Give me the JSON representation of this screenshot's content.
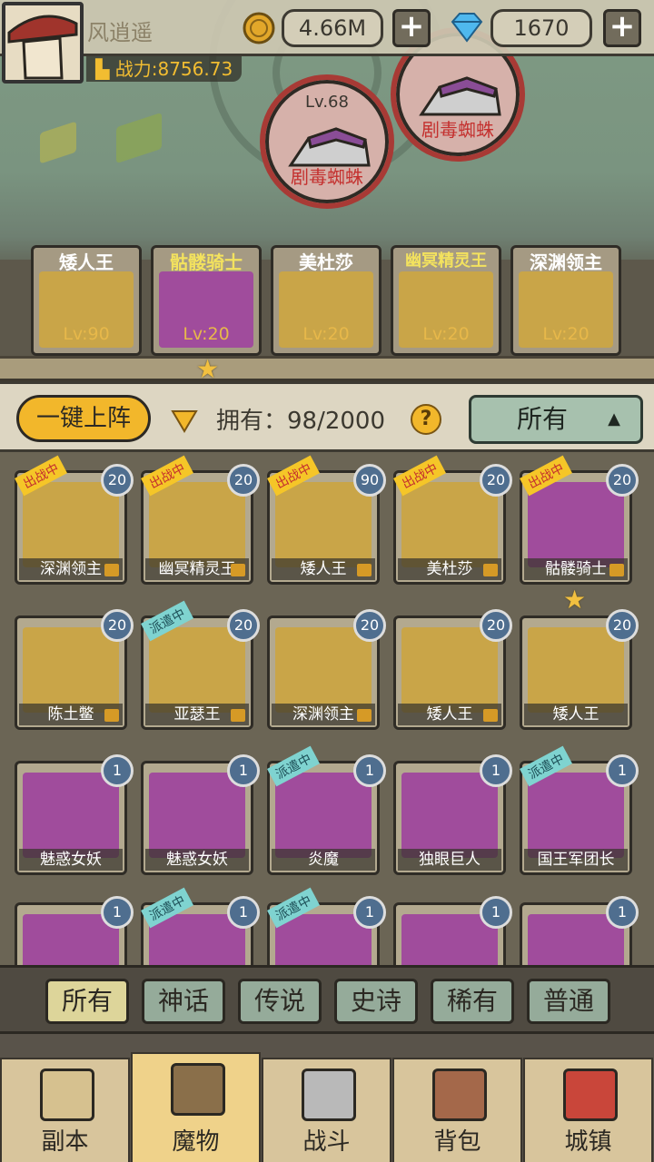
{
  "header": {
    "player_name": "风逍遥",
    "power_text": "战力:8756.73",
    "gold": "4.66M",
    "diamond": "1670"
  },
  "map_monsters": [
    {
      "level": "Lv.68",
      "name": "剧毒蜘蛛"
    },
    {
      "level": "",
      "name": "剧毒蜘蛛"
    }
  ],
  "team": [
    {
      "name": "矮人王",
      "level": "Lv:90",
      "rarity": "gold"
    },
    {
      "name": "骷髅骑士",
      "level": "Lv:20",
      "rarity": "purple"
    },
    {
      "name": "美杜莎",
      "level": "Lv:20",
      "rarity": "gold"
    },
    {
      "name": "幽冥精灵王",
      "level": "Lv:20",
      "rarity": "gold"
    },
    {
      "name": "深渊领主",
      "level": "Lv:20",
      "rarity": "gold"
    }
  ],
  "toolbar": {
    "auto_deploy_label": "一键上阵",
    "owned_label": "拥有：98/2000",
    "help": "?",
    "filter_value": "所有"
  },
  "grid": [
    {
      "name": "深渊领主",
      "badge": "20",
      "ribbon": "出战中",
      "rarity": "gold",
      "locked": true
    },
    {
      "name": "幽冥精灵王",
      "badge": "20",
      "ribbon": "出战中",
      "rarity": "gold",
      "locked": true
    },
    {
      "name": "矮人王",
      "badge": "90",
      "ribbon": "出战中",
      "rarity": "gold",
      "locked": true
    },
    {
      "name": "美杜莎",
      "badge": "20",
      "ribbon": "出战中",
      "rarity": "gold",
      "locked": true
    },
    {
      "name": "骷髅骑士",
      "badge": "20",
      "ribbon": "出战中",
      "rarity": "purple",
      "locked": true
    },
    {
      "name": "陈土鳖",
      "badge": "20",
      "ribbon": "",
      "rarity": "gold",
      "locked": true
    },
    {
      "name": "亚瑟王",
      "badge": "20",
      "ribbon": "派遣中",
      "rarity": "gold",
      "locked": true
    },
    {
      "name": "深渊领主",
      "badge": "20",
      "ribbon": "",
      "rarity": "gold",
      "locked": true
    },
    {
      "name": "矮人王",
      "badge": "20",
      "ribbon": "",
      "rarity": "gold",
      "locked": true
    },
    {
      "name": "矮人王",
      "badge": "20",
      "ribbon": "",
      "rarity": "gold",
      "locked": false
    },
    {
      "name": "魅惑女妖",
      "badge": "1",
      "ribbon": "",
      "rarity": "purple",
      "locked": false
    },
    {
      "name": "魅惑女妖",
      "badge": "1",
      "ribbon": "",
      "rarity": "purple",
      "locked": false
    },
    {
      "name": "炎魔",
      "badge": "1",
      "ribbon": "派遣中",
      "rarity": "purple",
      "locked": false
    },
    {
      "name": "独眼巨人",
      "badge": "1",
      "ribbon": "",
      "rarity": "purple",
      "locked": false
    },
    {
      "name": "国王军团长",
      "badge": "1",
      "ribbon": "派遣中",
      "rarity": "purple",
      "locked": false
    },
    {
      "name": "",
      "badge": "1",
      "ribbon": "",
      "rarity": "purple",
      "locked": false
    },
    {
      "name": "",
      "badge": "1",
      "ribbon": "派遣中",
      "rarity": "purple",
      "locked": false
    },
    {
      "name": "",
      "badge": "1",
      "ribbon": "派遣中",
      "rarity": "purple",
      "locked": false
    },
    {
      "name": "",
      "badge": "1",
      "ribbon": "",
      "rarity": "purple",
      "locked": false
    },
    {
      "name": "",
      "badge": "1",
      "ribbon": "",
      "rarity": "purple",
      "locked": false
    }
  ],
  "categories": [
    "所有",
    "神话",
    "传说",
    "史诗",
    "稀有",
    "普通"
  ],
  "bottom_nav": [
    {
      "label": "副本",
      "icon": "map-icon"
    },
    {
      "label": "魔物",
      "icon": "monster-helmet-icon"
    },
    {
      "label": "战斗",
      "icon": "crossed-swords-icon"
    },
    {
      "label": "背包",
      "icon": "backpack-icon"
    },
    {
      "label": "城镇",
      "icon": "town-icon"
    }
  ],
  "colors": {
    "gold_rarity": "#c9a548",
    "purple_rarity": "#a04c9c",
    "deployed_ribbon": "#f5c628",
    "dispatched_ribbon": "#7fd3d0",
    "accent": "#f2b72b"
  }
}
